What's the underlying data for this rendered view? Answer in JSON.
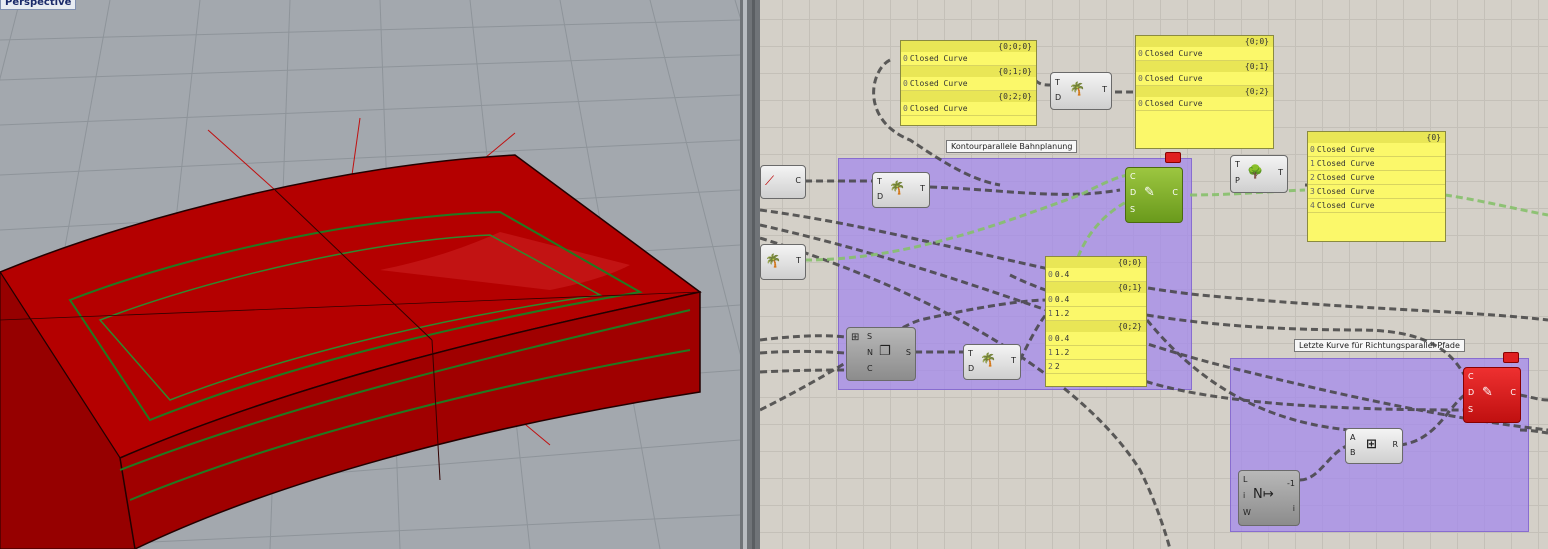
{
  "viewport": {
    "title": "Perspective"
  },
  "panels": {
    "p1": {
      "rows": [
        {
          "hdr": "{0;0;0}",
          "items": [
            {
              "i": "0",
              "t": "Closed Curve"
            }
          ]
        },
        {
          "hdr": "{0;1;0}",
          "items": [
            {
              "i": "0",
              "t": "Closed Curve"
            }
          ]
        },
        {
          "hdr": "{0;2;0}",
          "items": [
            {
              "i": "0",
              "t": "Closed Curve"
            }
          ]
        }
      ]
    },
    "p2": {
      "rows": [
        {
          "hdr": "{0;0}",
          "items": [
            {
              "i": "0",
              "t": "Closed Curve"
            }
          ]
        },
        {
          "hdr": "{0;1}",
          "items": [
            {
              "i": "0",
              "t": "Closed Curve"
            }
          ]
        },
        {
          "hdr": "{0;2}",
          "items": [
            {
              "i": "0",
              "t": "Closed Curve"
            }
          ]
        }
      ]
    },
    "p3": {
      "rows": [
        {
          "hdr": "{0}",
          "items": [
            {
              "i": "0",
              "t": "Closed Curve"
            },
            {
              "i": "1",
              "t": "Closed Curve"
            },
            {
              "i": "2",
              "t": "Closed Curve"
            },
            {
              "i": "3",
              "t": "Closed Curve"
            },
            {
              "i": "4",
              "t": "Closed Curve"
            }
          ]
        }
      ]
    },
    "p4": {
      "rows": [
        {
          "hdr": "{0;0}",
          "items": [
            {
              "i": "0",
              "t": "0.4"
            }
          ]
        },
        {
          "hdr": "{0;1}",
          "items": [
            {
              "i": "0",
              "t": "0.4"
            },
            {
              "i": "1",
              "t": "1.2"
            }
          ]
        },
        {
          "hdr": "{0;2}",
          "items": [
            {
              "i": "0",
              "t": "0.4"
            },
            {
              "i": "1",
              "t": "1.2"
            },
            {
              "i": "2",
              "t": "2"
            }
          ]
        }
      ]
    }
  },
  "groups": {
    "g1": "Kontourparallele Bahnplanung",
    "g2": "Letzte Kurve für Richtungsparallel Pfade"
  },
  "ports": {
    "T": "T",
    "D": "D",
    "C": "C",
    "S": "S",
    "N": "N",
    "P": "P",
    "A": "A",
    "B": "B",
    "R": "R",
    "L": "L",
    "i": "i",
    "W": "W",
    "minus1": "-1"
  }
}
